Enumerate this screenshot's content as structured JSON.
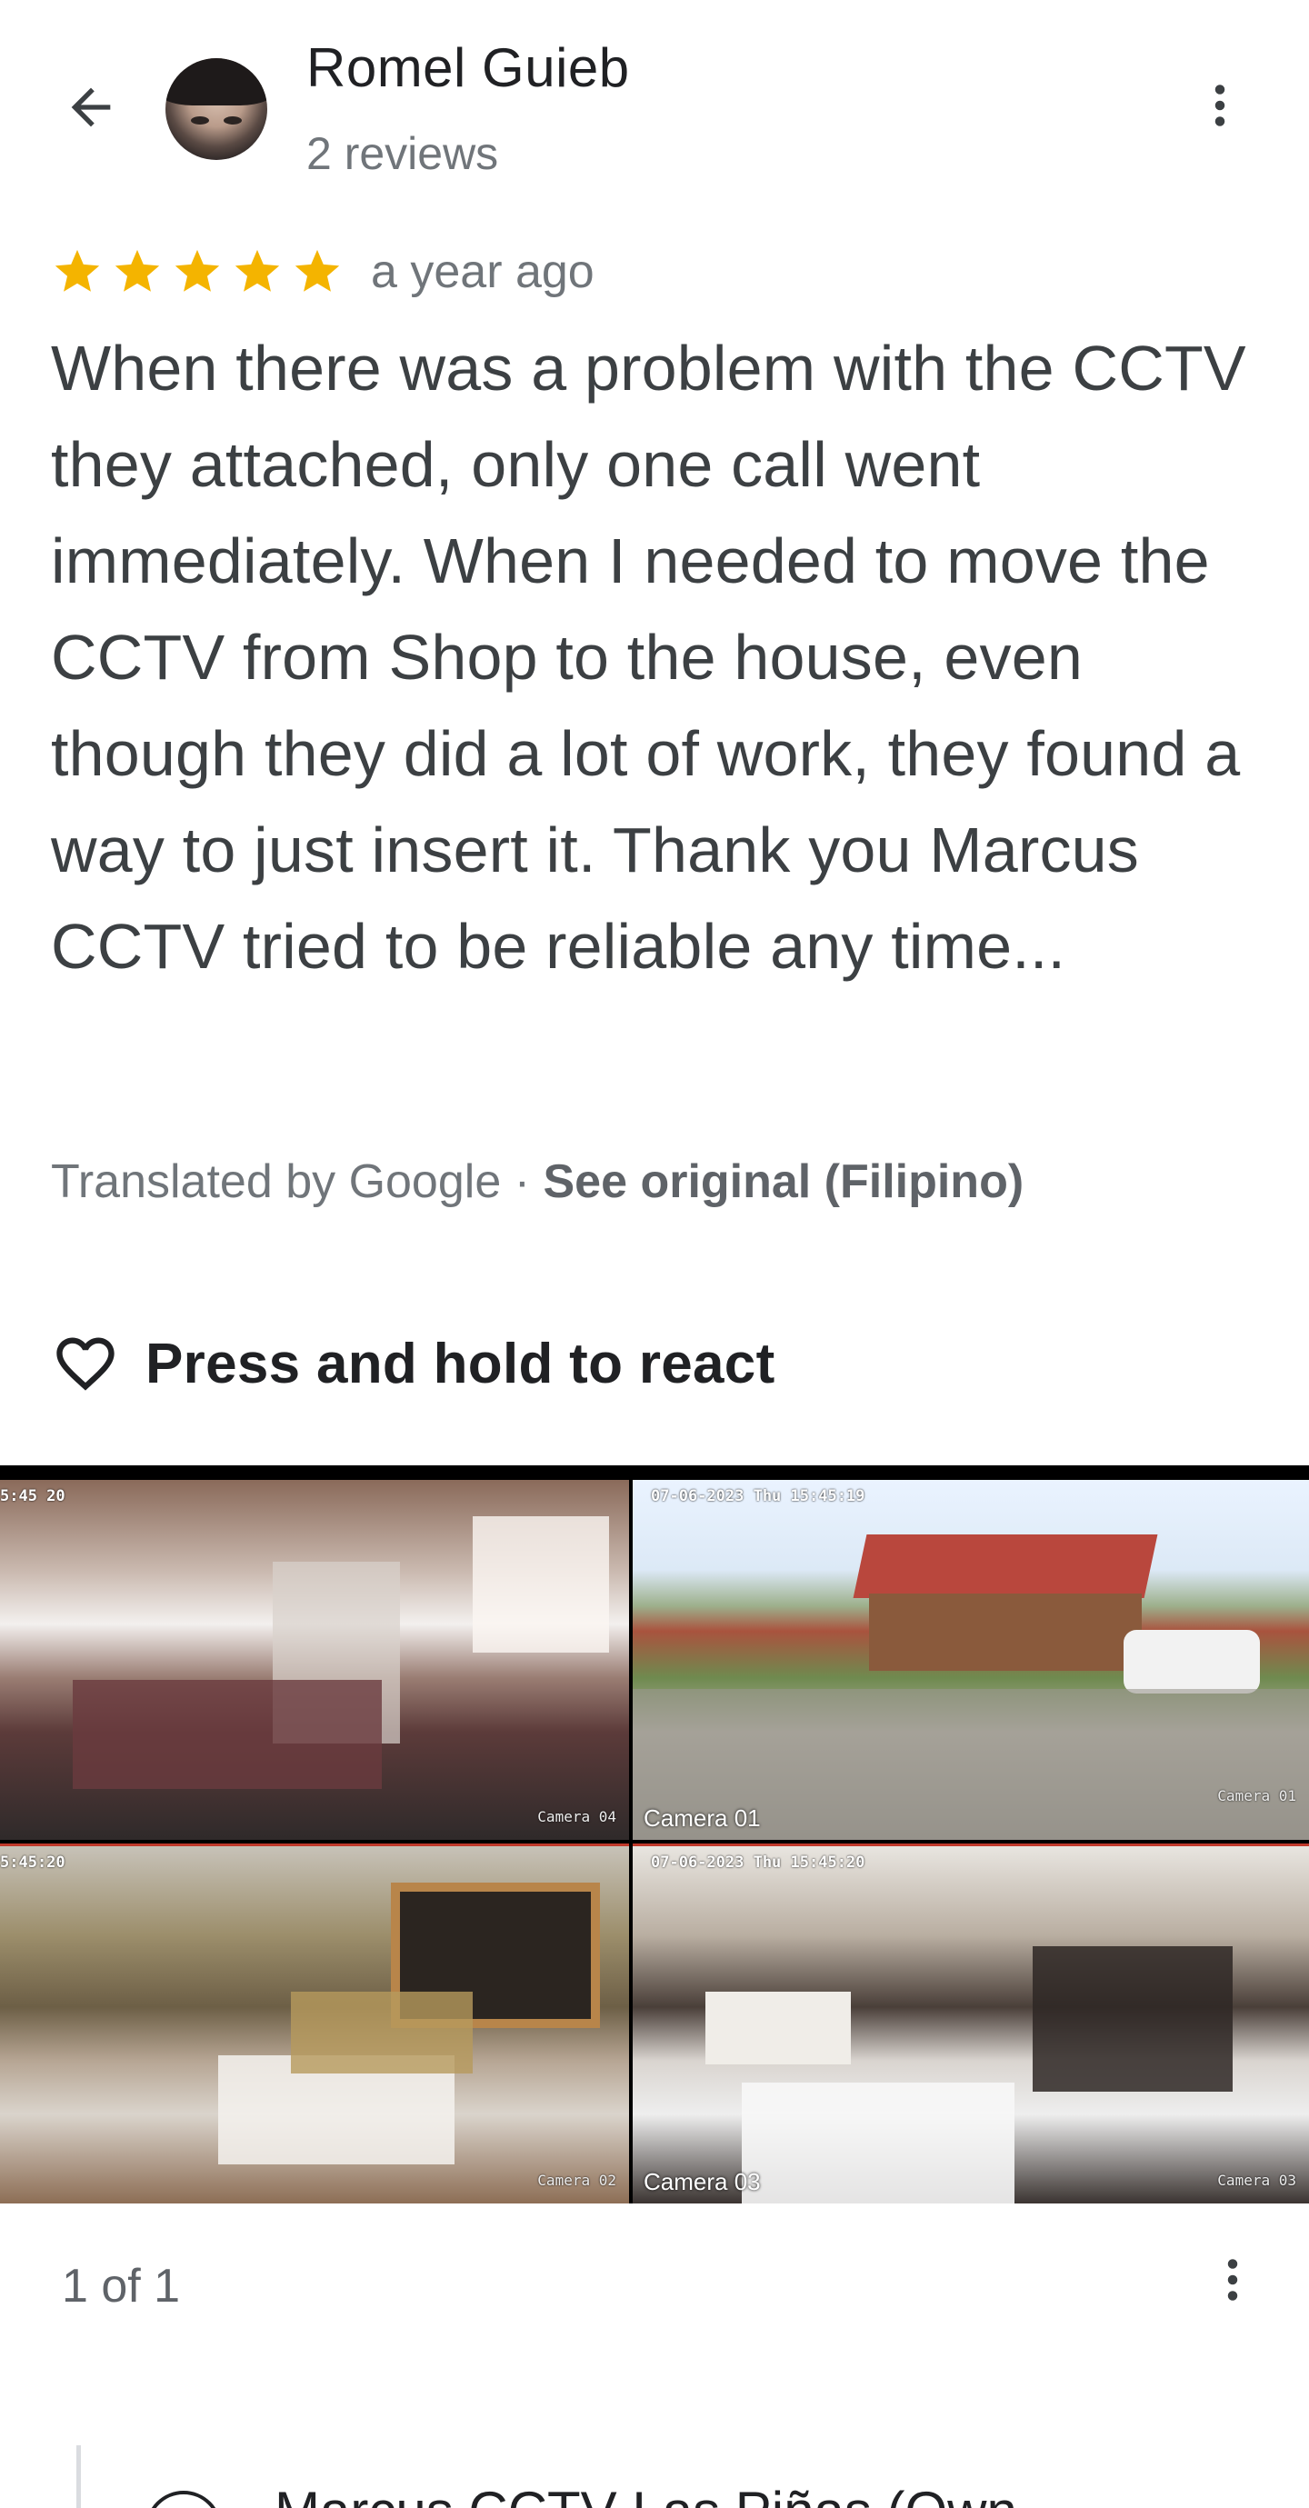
{
  "header": {
    "user_name": "Romel Guieb",
    "review_count": "2 reviews"
  },
  "review": {
    "rating": 5,
    "max_rating": 5,
    "star_color": "#F4B400",
    "time_ago": "a year ago",
    "text": "When there was a problem with the CCTV they attached, only one call went immediately. When I needed to move the CCTV from Shop to the house, even though they did a lot of work, they found a way to just insert it. Thank you Marcus CCTV tried to be reliable any time...",
    "translated_by": "Translated by Google · ",
    "see_original": "See original (Filipino)"
  },
  "react": {
    "label": "Press and hold to react"
  },
  "photo": {
    "cameras": [
      {
        "label": "",
        "tag": "Camera 04",
        "stamp": "5:45 20"
      },
      {
        "label": "Camera 01",
        "tag": "Camera 01",
        "stamp": "07-06-2023 Thu 15:45:19"
      },
      {
        "label": "",
        "tag": "Camera 02",
        "stamp": "5:45:20"
      },
      {
        "label": "Camera 03",
        "tag": "Camera 03",
        "stamp": "07-06-2023 Thu 15:45:20"
      }
    ],
    "pager": "1 of 1"
  },
  "owner_response": {
    "name": "Marcus CCTV Las Piñas (Own"
  },
  "icons": {
    "back": "arrow-left-icon",
    "more": "more-vert-icon",
    "star": "star-icon",
    "heart": "heart-outline-icon"
  }
}
